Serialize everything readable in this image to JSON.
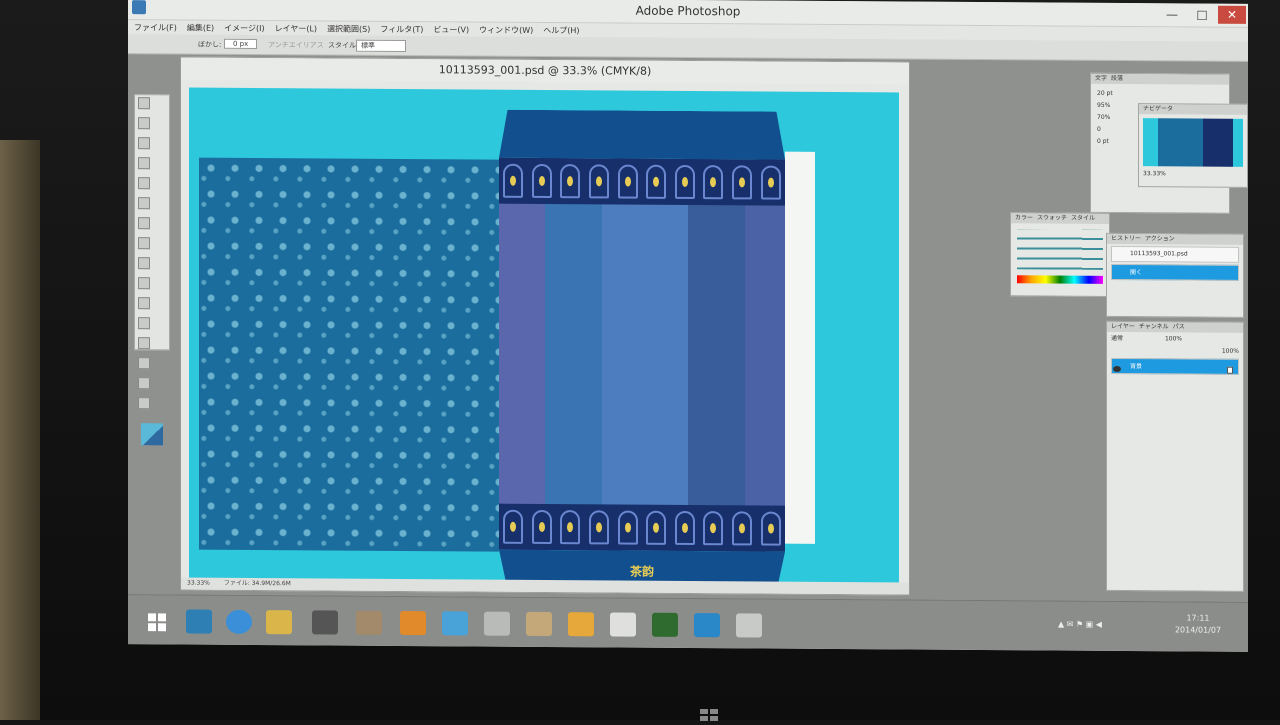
{
  "app": {
    "title": "Adobe Photoshop"
  },
  "window_controls": {
    "minimize": "—",
    "maximize": "□",
    "close": "✕"
  },
  "menu": [
    "ファイル(F)",
    "編集(E)",
    "イメージ(I)",
    "レイヤー(L)",
    "選択範囲(S)",
    "フィルタ(T)",
    "ビュー(V)",
    "ウィンドウ(W)",
    "ヘルプ(H)"
  ],
  "options": {
    "feather_label": "ぼかし:",
    "feather_value": "0 px",
    "antialias": "アンチエイリアス",
    "style_label": "スタイル:",
    "style_value": "標準"
  },
  "document": {
    "title": "10113593_001.psd @ 33.3% (CMYK/8)",
    "zoom": "33.33%",
    "file_info": "ファイル: 34.9M/26.6M",
    "logo_text": "茶韵"
  },
  "panels": {
    "character_tabs": [
      "文字",
      "段落"
    ],
    "character": {
      "size": "20 pt",
      "scale_v": "95%",
      "scale_h": "70%",
      "tracking": "0",
      "baseline": "0 pt"
    },
    "navigator_tab": "ナビゲータ",
    "navigator_zoom": "33.33%",
    "color_tabs": [
      "カラー",
      "スウォッチ",
      "スタイル"
    ],
    "history_tabs": [
      "ヒストリー",
      "アクション"
    ],
    "history_items": [
      "10113593_001.psd",
      "開く"
    ],
    "layers_tabs": [
      "レイヤー",
      "チャンネル",
      "パス"
    ],
    "layers_blend": "通常",
    "layers_opacity": "100%",
    "layers_fill": "100%",
    "layers_items": [
      "背景"
    ]
  },
  "clock": {
    "time": "17:11",
    "date": "2014/01/07"
  },
  "colors": {
    "canvas": "#2ec8dc",
    "accent": "#1e9be0",
    "bag_dark": "#124f8f"
  }
}
